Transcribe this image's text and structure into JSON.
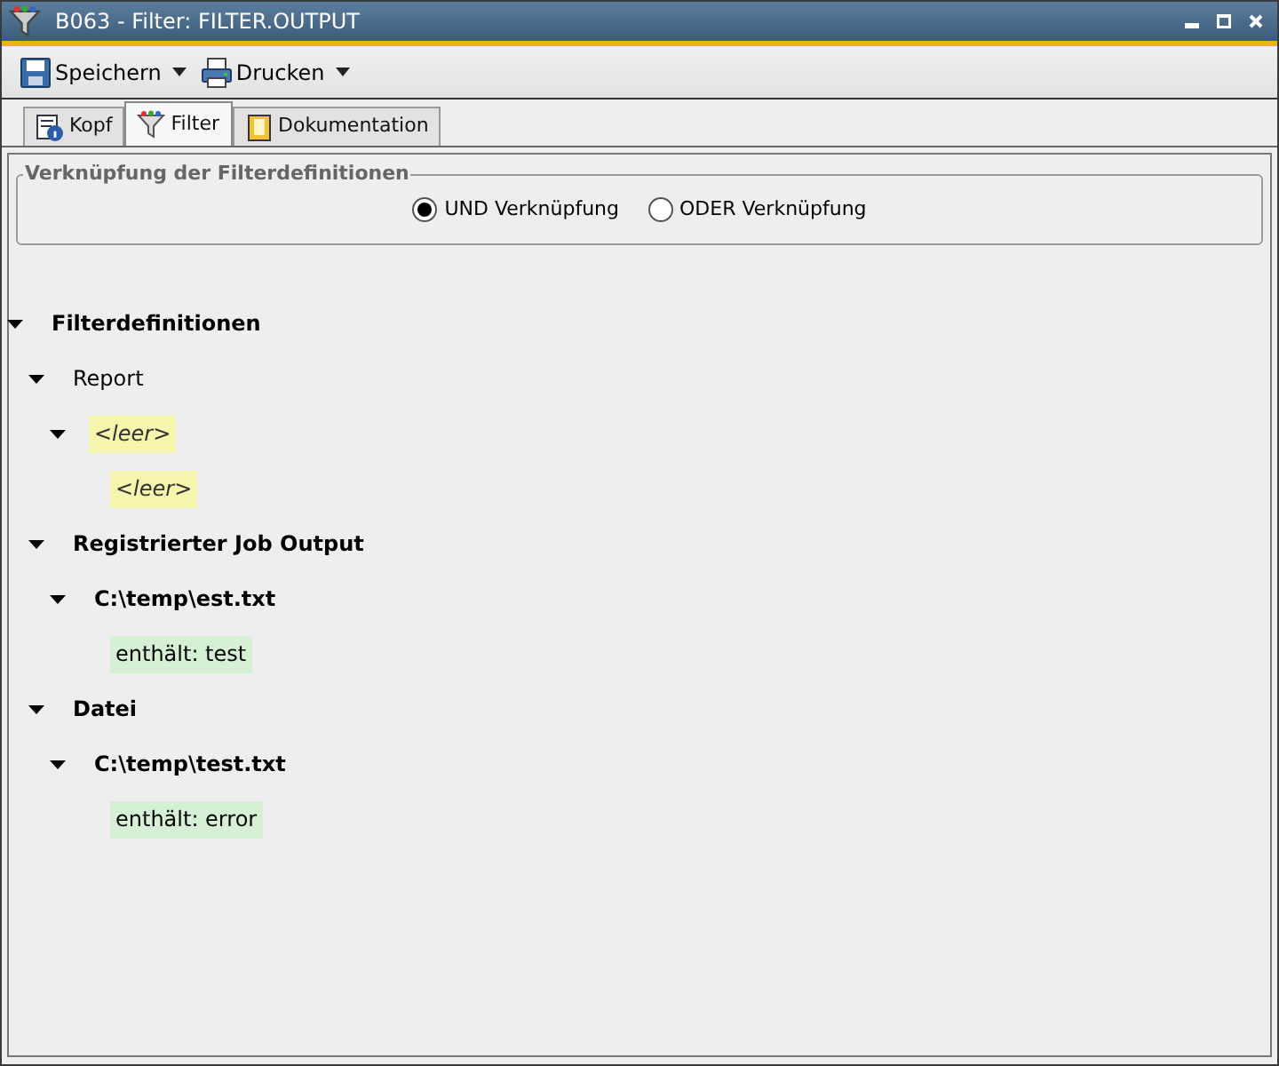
{
  "window": {
    "title": "B063 - Filter: FILTER.OUTPUT"
  },
  "toolbar": [
    {
      "label": "Speichern",
      "kind": "save"
    },
    {
      "label": "Drucken",
      "kind": "print"
    }
  ],
  "tabs": [
    {
      "label": "Kopf",
      "kind": "info",
      "selected": false
    },
    {
      "label": "Filter",
      "kind": "filter",
      "selected": true
    },
    {
      "label": "Dokumentation",
      "kind": "book",
      "selected": false
    }
  ],
  "link_group": {
    "title": "Verknüpfung der Filterdefinitionen",
    "options": [
      {
        "label": "UND Verknüpfung",
        "selected": true
      },
      {
        "label": "ODER Verknüpfung",
        "selected": false
      }
    ]
  },
  "tree": [
    {
      "label": "Filterdefinitionen",
      "kind": "group",
      "expanded": true,
      "children": [
        {
          "label": "Report",
          "kind": "plain",
          "expanded": true,
          "children": [
            {
              "label": "<leer>",
              "kind": "empty",
              "color": "#f5f5ad",
              "expanded": true,
              "children": [
                {
                  "label": "<leer>",
                  "kind": "empty",
                  "color": "#f5f5ad"
                }
              ]
            }
          ]
        },
        {
          "label": "Registrierter Job Output",
          "kind": "group",
          "expanded": true,
          "children": [
            {
              "label": "C:\\temp\\est.txt",
              "kind": "group",
              "expanded": true,
              "children": [
                {
                  "label": "enthält: test",
                  "kind": "condition",
                  "color": "#d6f0d6"
                }
              ]
            }
          ]
        },
        {
          "label": "Datei",
          "kind": "group",
          "expanded": true,
          "children": [
            {
              "label": "C:\\temp\\test.txt",
              "kind": "group",
              "expanded": true,
              "children": [
                {
                  "label": "enthält: error",
                  "kind": "condition",
                  "color": "#d6f0d6"
                }
              ]
            }
          ]
        }
      ]
    }
  ]
}
